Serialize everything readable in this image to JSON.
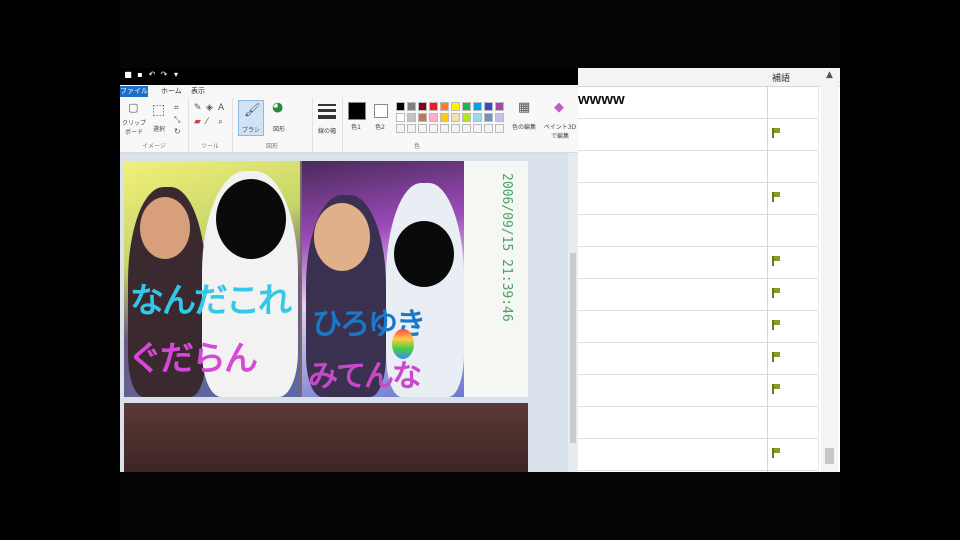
{
  "paint": {
    "menu_tabs": [
      "ファイル",
      "ホーム",
      "表示"
    ],
    "ribbon": {
      "groups": [
        "イメージ",
        "ツール",
        "図形",
        "色"
      ],
      "buttons": {
        "clipboard": "クリップボード",
        "select": "選択",
        "brush": "ブラシ",
        "shapes": "図形",
        "line_width": "線の幅",
        "color1": "色1",
        "color2": "色2",
        "edit_colors": "色の編集",
        "paint3d": "ペイント3Dで編集"
      },
      "color1_hex": "#000000",
      "color2_hex": "#ffffff",
      "palette": [
        "#000000",
        "#7f7f7f",
        "#880015",
        "#ed1c24",
        "#ff7f27",
        "#fff200",
        "#22b14c",
        "#00a2e8",
        "#3f48cc",
        "#a349a4",
        "#ffffff",
        "#c3c3c3",
        "#b97a57",
        "#ffaec9",
        "#ffc90e",
        "#efe4b0",
        "#b5e61d",
        "#99d9ea",
        "#7092be",
        "#c8bfe7"
      ]
    },
    "canvas_image": {
      "stamp_text": "2006/09/15 21:39:46",
      "scribble_1": "なんだこれ",
      "scribble_2": "ぐだらん",
      "scribble_3": "ひろゆき",
      "scribble_4": "みてんな"
    }
  },
  "side_panel": {
    "header": "補語",
    "rows": [
      {
        "text": "wwww",
        "flag": false
      },
      {
        "text": "",
        "flag": true
      },
      {
        "text": "",
        "flag": false
      },
      {
        "text": "",
        "flag": true
      },
      {
        "text": "",
        "flag": false
      },
      {
        "text": "",
        "flag": true
      },
      {
        "text": "",
        "flag": true
      },
      {
        "text": "",
        "flag": true
      },
      {
        "text": "",
        "flag": true
      },
      {
        "text": "",
        "flag": true
      },
      {
        "text": "",
        "flag": false
      },
      {
        "text": "",
        "flag": true
      }
    ]
  }
}
